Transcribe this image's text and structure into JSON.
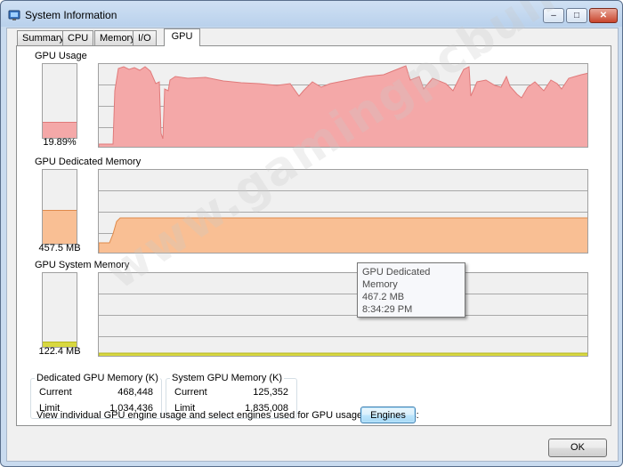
{
  "window": {
    "title": "System Information",
    "icon": "system-info-icon"
  },
  "caption_buttons": {
    "minimize": "–",
    "maximize": "□",
    "close": "✕"
  },
  "tabs": [
    {
      "label": "Summary",
      "active": false
    },
    {
      "label": "CPU",
      "active": false
    },
    {
      "label": "Memory",
      "active": false
    },
    {
      "label": "I/O",
      "active": false
    },
    {
      "label": "GPU",
      "active": true
    }
  ],
  "sections": {
    "usage": {
      "label": "GPU Usage",
      "value": "19.89%",
      "meter_fraction": 0.199,
      "color": "#f4a8a8",
      "line": "#e07a7a"
    },
    "dedicated": {
      "label": "GPU Dedicated Memory",
      "value": "457.5 MB",
      "meter_fraction": 0.44,
      "color": "#f9bf94",
      "line": "#e08a4a"
    },
    "system": {
      "label": "GPU System Memory",
      "value": "122.4 MB",
      "meter_fraction": 0.066,
      "color": "#d8d840",
      "line": "#b5b520"
    }
  },
  "tooltip": {
    "title": "GPU Dedicated Memory",
    "value": "467.2 MB",
    "time": "8:34:29 PM"
  },
  "dedicated_box": {
    "title": "Dedicated GPU Memory (K)",
    "current_label": "Current",
    "current_value": "468,448",
    "limit_label": "Limit",
    "limit_value": "1,034,436"
  },
  "system_box": {
    "title": "System GPU Memory (K)",
    "current_label": "Current",
    "current_value": "125,352",
    "limit_label": "Limit",
    "limit_value": "1,835,008"
  },
  "engines_text": "View individual GPU engine usage and select engines used for GPU usage calculations:",
  "engines_button": "Engines",
  "ok_button": "OK",
  "watermark": "www.gamingpcbuilder.com"
}
